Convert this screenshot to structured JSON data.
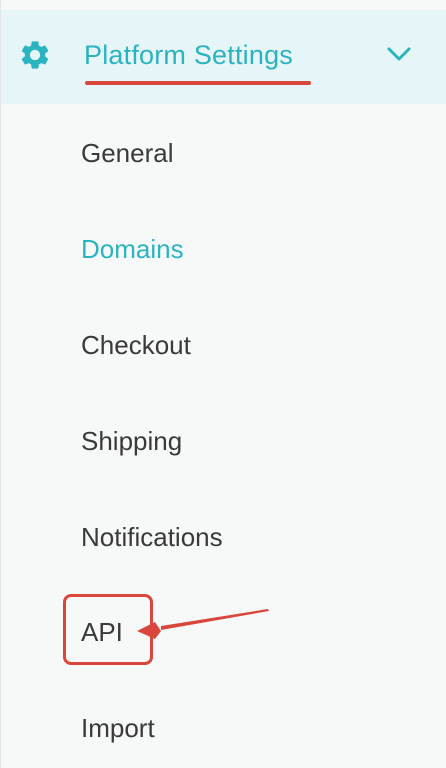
{
  "section": {
    "title": "Platform Settings",
    "icon": "gear-icon",
    "expand_icon": "chevron-down-icon",
    "accent_color": "#2bb3c0",
    "header_bg": "#e6f6f8"
  },
  "nav": {
    "items": [
      {
        "label": "General",
        "active": false
      },
      {
        "label": "Domains",
        "active": true
      },
      {
        "label": "Checkout",
        "active": false
      },
      {
        "label": "Shipping",
        "active": false
      },
      {
        "label": "Notifications",
        "active": false
      },
      {
        "label": "API",
        "active": false,
        "highlighted": true
      },
      {
        "label": "Import",
        "active": false
      }
    ]
  },
  "annotation": {
    "color": "#d9473c",
    "target": "API"
  }
}
